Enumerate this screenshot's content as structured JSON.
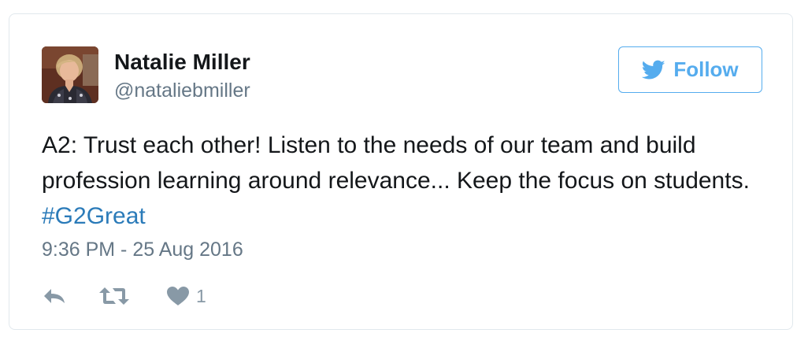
{
  "tweet": {
    "author_name": "Natalie Miller",
    "author_handle": "@nataliebmiller",
    "follow_label": "Follow",
    "text_before_hashtag": "A2: Trust each other! Listen to the needs of our team and build profession learning around relevance... Keep the focus on students. ",
    "hashtag": "#G2Great",
    "timestamp": "9:36 PM - 25 Aug 2016",
    "like_count": "1"
  },
  "icons": {
    "follow": "twitter-bird-icon",
    "reply": "reply-icon",
    "retweet": "retweet-icon",
    "like": "heart-icon"
  },
  "colors": {
    "accent": "#55acee",
    "hashtag": "#2b7bb9",
    "text": "#14171a",
    "muted": "#657786",
    "icon": "#8899a6",
    "border": "#e1e8ed"
  }
}
